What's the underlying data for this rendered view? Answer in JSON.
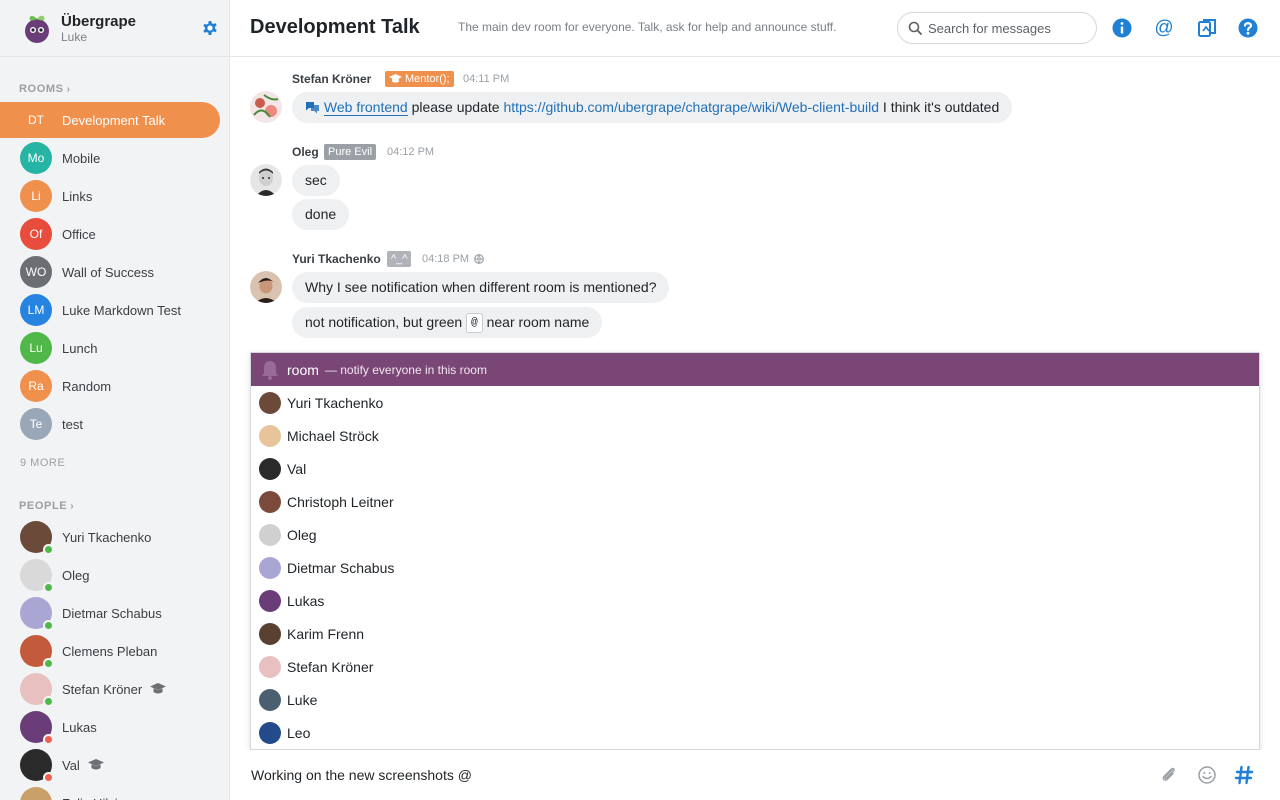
{
  "org": {
    "name": "Übergrape",
    "user": "Luke"
  },
  "sidebar": {
    "rooms_title": "ROOMS",
    "rooms": [
      {
        "badge": "DT",
        "label": "Development Talk",
        "color": "#f0904d",
        "active": true
      },
      {
        "badge": "Mo",
        "label": "Mobile",
        "color": "#26b5a4"
      },
      {
        "badge": "Li",
        "label": "Links",
        "color": "#f0904d"
      },
      {
        "badge": "Of",
        "label": "Office",
        "color": "#e74c3c"
      },
      {
        "badge": "WO",
        "label": "Wall of Success",
        "color": "#6b6f74"
      },
      {
        "badge": "LM",
        "label": "Luke Markdown Test",
        "color": "#2684e0",
        "locked": true
      },
      {
        "badge": "Lu",
        "label": "Lunch",
        "color": "#4fb848"
      },
      {
        "badge": "Ra",
        "label": "Random",
        "color": "#f0904d"
      },
      {
        "badge": "Te",
        "label": "test",
        "color": "#9aa7b8"
      }
    ],
    "more_label": "9 MORE",
    "people_title": "PEOPLE",
    "people": [
      {
        "name": "Yuri Tkachenko",
        "status": "online",
        "avatar_color": "#6b4a3a"
      },
      {
        "name": "Oleg",
        "status": "online",
        "avatar_color": "#d9d9d9"
      },
      {
        "name": "Dietmar Schabus",
        "status": "online",
        "avatar_color": "#a9a6d4"
      },
      {
        "name": "Clemens Pleban",
        "status": "online",
        "avatar_color": "#c45a3c"
      },
      {
        "name": "Stefan Kröner",
        "status": "online",
        "avatar_color": "#e8c0c0",
        "mentor": true
      },
      {
        "name": "Lukas",
        "status": "away",
        "avatar_color": "#6a3d78"
      },
      {
        "name": "Val",
        "status": "away",
        "avatar_color": "#2a2a2a",
        "mentor": true
      },
      {
        "name": "Felix Hilzinger",
        "status": "online",
        "avatar_color": "#c9a06a"
      }
    ]
  },
  "header": {
    "title": "Development Talk",
    "description": "The main dev room for everyone. Talk, ask for help and announce stuff.",
    "search_placeholder": "Search for messages"
  },
  "messages": [
    {
      "author": "Stefan Kröner",
      "role": "Mentor();",
      "time": "04:11 PM",
      "avatar_color": "#e8c0c0",
      "parts": {
        "link_label": "Web frontend",
        "text1": " please update ",
        "url": "https://github.com/ubergrape/chatgrape/wiki/Web-client-build",
        "text2": " I think it's outdated"
      }
    },
    {
      "author": "Oleg",
      "role": "Pure Evil",
      "time": "04:12 PM",
      "avatar_color": "#d9d9d9",
      "lines": [
        "sec",
        "done"
      ]
    },
    {
      "author": "Yuri Tkachenko",
      "role": "^_^",
      "time": "04:18 PM",
      "avatar_color": "#6b4a3a",
      "lines": [
        "Why I see notification when different room is mentioned?"
      ],
      "line2": {
        "before": "not notification, but green ",
        "code": "@",
        "after": " near room name"
      }
    }
  ],
  "mention": {
    "room_label": "room",
    "room_desc": "— notify everyone in this room",
    "users": [
      {
        "name": "Yuri Tkachenko",
        "color": "#6b4a3a"
      },
      {
        "name": "Michael Ströck",
        "color": "#e8c49a"
      },
      {
        "name": "Val",
        "color": "#2a2a2a"
      },
      {
        "name": "Christoph Leitner",
        "color": "#7a4a3a"
      },
      {
        "name": "Oleg",
        "color": "#d0d0d0"
      },
      {
        "name": "Dietmar Schabus",
        "color": "#a9a6d4"
      },
      {
        "name": "Lukas",
        "color": "#6a3d78"
      },
      {
        "name": "Karim Frenn",
        "color": "#5a4030"
      },
      {
        "name": "Stefan Kröner",
        "color": "#e8c0c0"
      },
      {
        "name": "Luke",
        "color": "#4a6070"
      },
      {
        "name": "Leo",
        "color": "#234a8a"
      }
    ]
  },
  "composer": {
    "value": "Working on the new screenshots @"
  },
  "colors": {
    "accent": "#f0904d",
    "mention_highlight": "#7a4676",
    "link": "#2271b8",
    "icon_blue": "#1f80d6"
  }
}
